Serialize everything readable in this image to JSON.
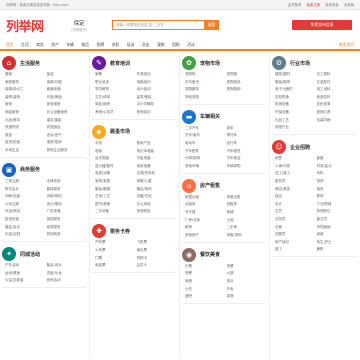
{
  "topbar": {
    "left": "列举网 - 免费分类信息发布网 · lieju.com",
    "right": [
      "会员登录",
      "免费注册",
      "发布信息",
      "手机版"
    ]
  },
  "header": {
    "logo": "列举网",
    "city_name": "保定",
    "city_switch": "[切换城市]",
    "search_placeholder": "请输入你要找的信息,如:二手车",
    "search_button": "搜索",
    "post_button": "免费发布信息"
  },
  "nav": {
    "items": [
      "首页",
      "生活",
      "商务",
      "房产",
      "车辆",
      "物品",
      "招聘",
      "求职",
      "培训",
      "交友",
      "宠物",
      "团购",
      "活动"
    ],
    "more": "更多类目"
  },
  "columns": [
    {
      "sections": [
        {
          "title": "生活服务",
          "color": "#d32f2f",
          "icon": "home-service-icon",
          "links": [
            "搬家",
            "保洁",
            "家政服务",
            "保姆/月嫂",
            "保姆/钟点工",
            "管道疏通",
            "装修/装饰",
            "开锁/换锁",
            "维修",
            "家电维修",
            "电脑维修",
            "办公设备维修",
            "礼品/鲜花",
            "婚庆/摄影",
            "快递物流",
            "宾馆酒店",
            "旅游",
            "送水/送气",
            "投资/担保",
            "维修/招商",
            "本地生活",
            "其他生活服务"
          ]
        },
        {
          "title": "商务服务",
          "color": "#1565c0",
          "icon": "business-icon",
          "links": [
            "工商注册",
            "法律咨询",
            "财务会计",
            "翻译服务",
            "印刷/包装",
            "网络/网站",
            "公司注册",
            "设计/策划",
            "货运/物流",
            "广告传媒",
            "投资担保",
            "保险服务",
            "展会/会议",
            "商务服务",
            "礼品/定制",
            "其他商务"
          ]
        },
        {
          "title": "同城活动",
          "color": "#00897b",
          "icon": "event-icon",
          "links": [
            "户外活动",
            "聚会/派对",
            "运动/健身",
            "讲座/沙龙",
            "公益/志愿者",
            "其他活动"
          ]
        }
      ]
    },
    {
      "sections": [
        {
          "title": "教育培训",
          "color": "#6a1b9a",
          "icon": "education-icon",
          "links": [
            "家教",
            "外语培训",
            "职业培训",
            "电脑培训",
            "学历教育",
            "设计培训",
            "文艺/体育",
            "留学/移民",
            "驾校/陪练",
            "中小学辅导",
            "考研/公务员",
            "其他培训"
          ]
        },
        {
          "title": "跳蚤市场",
          "color": "#f9a825",
          "icon": "market-icon",
          "links": [
            "手机",
            "数码产品",
            "电脑",
            "笔记本电脑",
            "台式电脑",
            "平板电脑",
            "显示器/配件",
            "家用电器",
            "电视/冰箱",
            "空调/洗衣机",
            "家具/家居",
            "母婴/儿童",
            "服装/鞋帽",
            "箱包/首饰",
            "艺术/工艺",
            "收藏/古玩",
            "图书/音像",
            "办公用品",
            "二手设备",
            "其他物品"
          ]
        },
        {
          "title": "票务卡券",
          "color": "#e53935",
          "icon": "ticket-icon",
          "links": [
            "汽车票",
            "飞机票",
            "火车票",
            "演出票",
            "门票",
            "购物卡",
            "电影票",
            "会员卡"
          ]
        }
      ]
    },
    {
      "sections": [
        {
          "title": "宠物市场",
          "color": "#43a047",
          "icon": "pet-icon",
          "links": [
            "宠物狗",
            "宠物猫",
            "花鸟鱼虫",
            "宠物用品",
            "宠物服务",
            "狗狗配种",
            "其他宠物"
          ]
        },
        {
          "title": "车辆相关",
          "color": "#1976d2",
          "icon": "car-icon",
          "links": [
            "二手汽车",
            "新车",
            "货车/客车",
            "摩托车",
            "电动车",
            "自行车",
            "汽车配件",
            "汽车租赁",
            "代驾/陪驾",
            "汽车美容",
            "其他车辆",
            "车辆求购"
          ]
        },
        {
          "title": "房产租售",
          "color": "#ff7043",
          "icon": "house-icon",
          "links": [
            "房屋出租",
            "房屋出售",
            "合租房",
            "短租房",
            "写字楼",
            "商铺",
            "厂房/仓库",
            "土地",
            "新房",
            "二手房",
            "其他房产",
            "求租/求购"
          ]
        },
        {
          "title": "餐饮美食",
          "color": "#8d6e63",
          "icon": "food-icon",
          "links": [
            "中餐",
            "西餐",
            "快餐",
            "火锅",
            "烧烤",
            "甜点",
            "小吃",
            "外卖",
            "酒吧",
            "茶馆"
          ]
        }
      ]
    },
    {
      "sections": [
        {
          "title": "行业市场",
          "color": "#607d8b",
          "icon": "industry-icon",
          "links": [
            "建筑/建材",
            "化工原料",
            "服装/服饰",
            "五金配件",
            "电子元器件",
            "电工电料",
            "农林牧渔",
            "食品饮料",
            "机械设备",
            "纺织皮革",
            "环保设备",
            "照明灯具",
            "礼品工艺",
            "包装印刷",
            "其他行业"
          ]
        },
        {
          "title": "企业招聘",
          "color": "#e53935",
          "icon": "job-icon",
          "links": [
            "销售",
            "客服",
            "人事/行政",
            "财务/会计",
            "技工/普工",
            "司机",
            "服务员",
            "厨师",
            "美容/美发",
            "保安",
            "保洁",
            "教师",
            "设计",
            "IT/互联网",
            "文员",
            "其他职位",
            "业务员",
            "营业员",
            "仓管",
            "市场营销",
            "送餐员",
            "家政",
            "房产经纪",
            "医生/护士",
            "普工",
            "兼职"
          ]
        }
      ]
    }
  ]
}
